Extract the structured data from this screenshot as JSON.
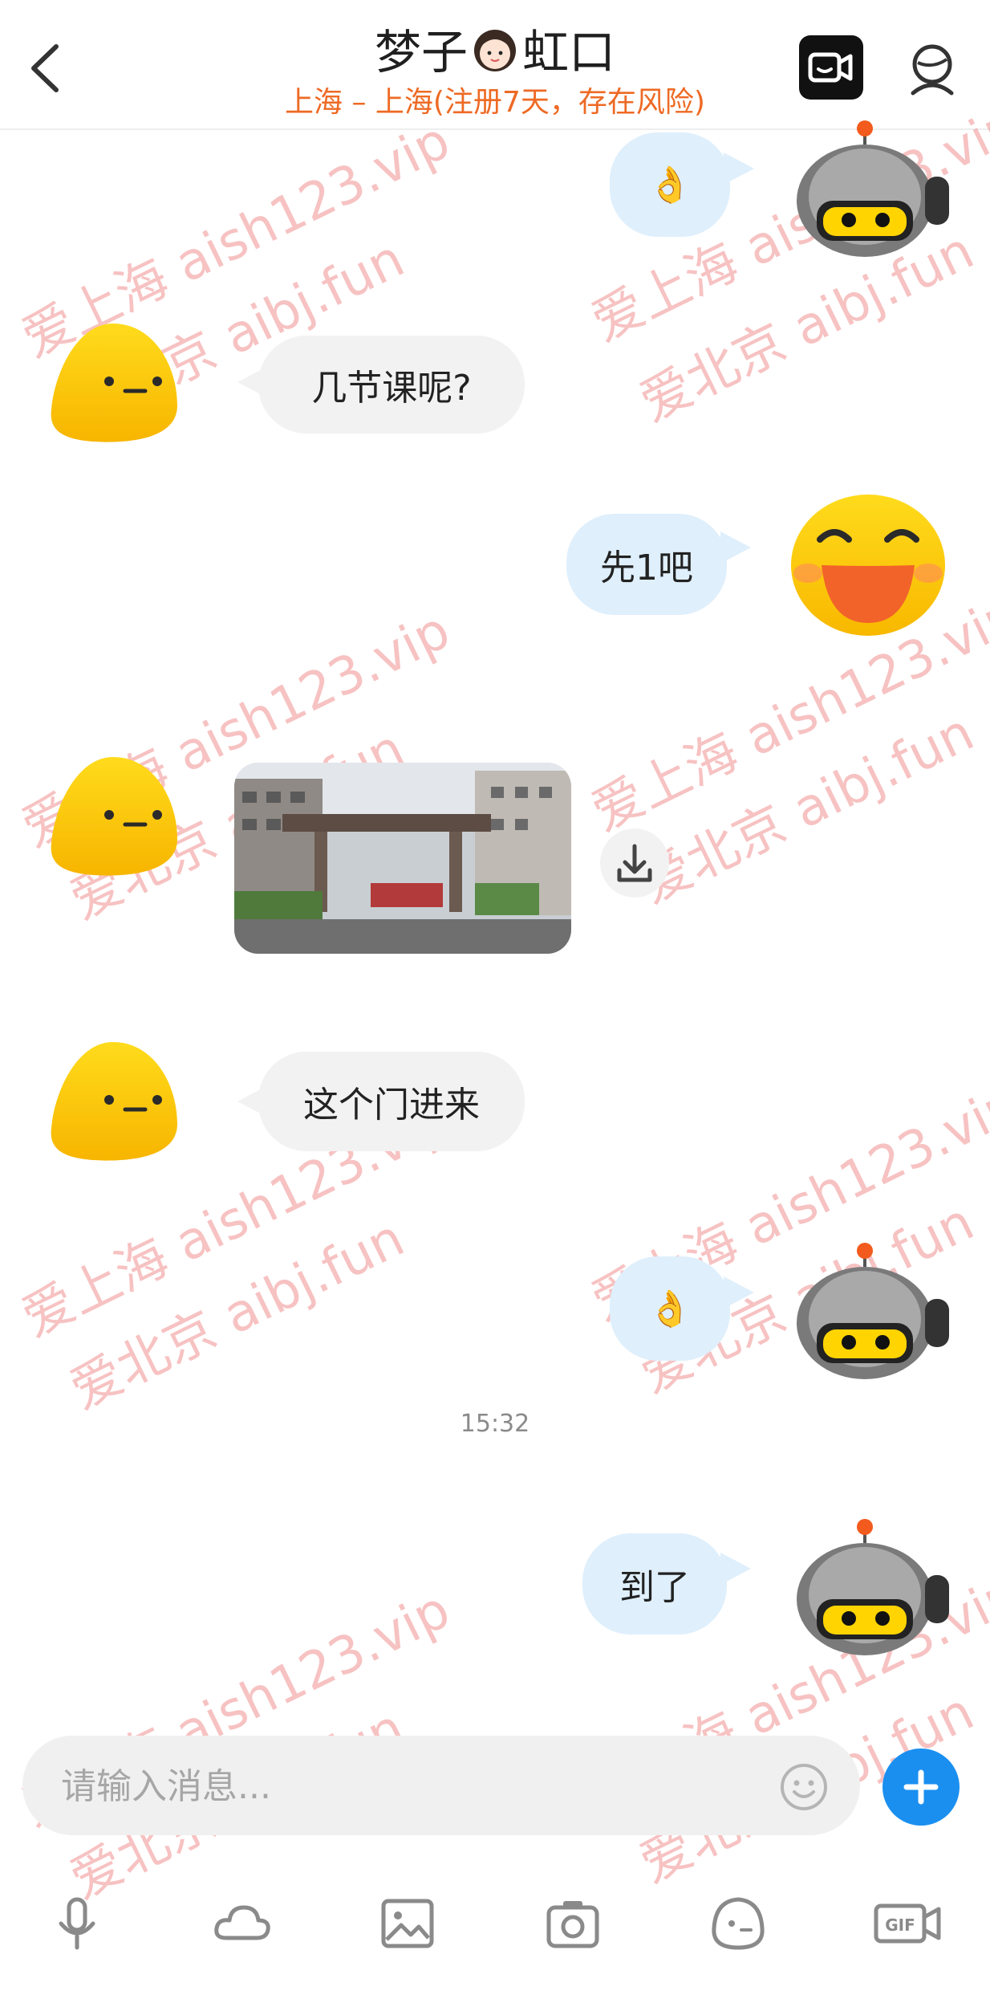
{
  "header": {
    "title_left": "梦子",
    "title_right": "虹口",
    "subtitle": "上海 – 上海(注册7天，存在风险)"
  },
  "messages": [
    {
      "side": "out",
      "kind": "emoji",
      "text": "👌",
      "avatar": "robot-avatar"
    },
    {
      "side": "in",
      "kind": "text",
      "text": "几节课呢?",
      "avatar": "yellow-blob-avatar"
    },
    {
      "side": "out",
      "kind": "text",
      "text": "先1吧",
      "avatar": "laughing-emoji-avatar"
    },
    {
      "side": "in",
      "kind": "image",
      "avatar": "yellow-blob-avatar"
    },
    {
      "side": "in",
      "kind": "text",
      "text": "这个门进来",
      "avatar": "yellow-blob-avatar"
    },
    {
      "side": "out",
      "kind": "emoji",
      "text": "👌",
      "avatar": "robot-avatar"
    },
    {
      "side": "out",
      "kind": "text",
      "text": "到了",
      "avatar": "robot-avatar"
    }
  ],
  "timestamp": "15:32",
  "input": {
    "placeholder": "请输入消息..."
  },
  "toolbar": [
    "microphone-icon",
    "cloud-icon",
    "image-icon",
    "camera-icon",
    "emoji-face-icon",
    "gif-icon"
  ],
  "toolbar_gif_label": "GIF",
  "watermark": {
    "line1": "爱上海 aish123.vip",
    "line2": "爱北京 aibj.fun"
  },
  "colors": {
    "accent": "#1a8ff0",
    "subtitle": "#ee6a24",
    "bubble_in": "#f2f2f2",
    "bubble_out": "#dfeffc",
    "watermark": "#eb6e6e"
  }
}
